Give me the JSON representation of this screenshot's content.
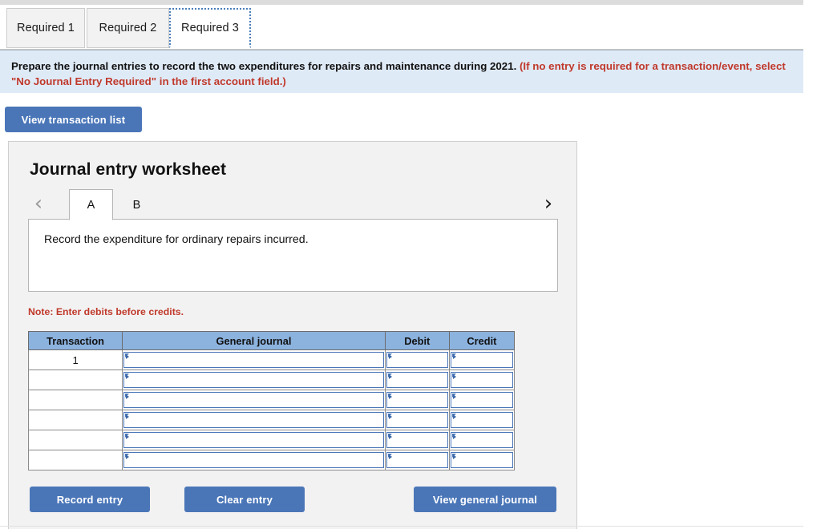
{
  "required_tabs": [
    {
      "label": "Required 1",
      "active": false
    },
    {
      "label": "Required 2",
      "active": false
    },
    {
      "label": "Required 3",
      "active": true
    }
  ],
  "instruction": {
    "main": "Prepare the journal entries to record the two expenditures for repairs and maintenance during 2021.",
    "hint": "(If no entry is required for a transaction/event, select \"No Journal Entry Required\" in the first account field.)"
  },
  "toolbar": {
    "view_transaction_list_label": "View transaction list"
  },
  "worksheet": {
    "title": "Journal entry worksheet",
    "nav": {
      "prev_icon": "‹",
      "next_icon": "›"
    },
    "entry_tabs": [
      {
        "label": "A",
        "active": true
      },
      {
        "label": "B",
        "active": false
      }
    ],
    "description": "Record the expenditure for ordinary repairs incurred.",
    "note": "Note: Enter debits before credits.",
    "table": {
      "headers": [
        "Transaction",
        "General journal",
        "Debit",
        "Credit"
      ],
      "rows": [
        {
          "transaction": "1",
          "general_journal": "",
          "debit": "",
          "credit": ""
        },
        {
          "transaction": "",
          "general_journal": "",
          "debit": "",
          "credit": ""
        },
        {
          "transaction": "",
          "general_journal": "",
          "debit": "",
          "credit": ""
        },
        {
          "transaction": "",
          "general_journal": "",
          "debit": "",
          "credit": ""
        },
        {
          "transaction": "",
          "general_journal": "",
          "debit": "",
          "credit": ""
        },
        {
          "transaction": "",
          "general_journal": "",
          "debit": "",
          "credit": ""
        }
      ]
    },
    "buttons": {
      "record_entry": "Record entry",
      "clear_entry": "Clear entry",
      "view_general_journal": "View general journal"
    }
  },
  "colors": {
    "button_blue": "#4a76b8",
    "header_blue": "#8cb2de",
    "banner_blue": "#dfeaf7",
    "note_red": "#c0392b",
    "panel_gray": "#f2f2f2"
  }
}
